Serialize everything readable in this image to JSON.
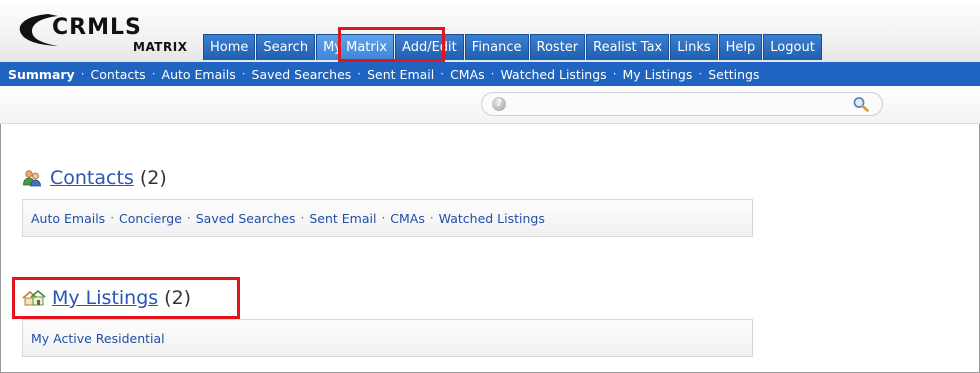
{
  "brand": {
    "logo_text": "CRMLS",
    "logo_subtext": "MATRIX",
    "accent_color": "#1e64c0",
    "highlight_color": "#e1151a"
  },
  "main_tabs": [
    {
      "label": "Home"
    },
    {
      "label": "Search"
    },
    {
      "label": "My Matrix",
      "active": true
    },
    {
      "label": "Add/Edit"
    },
    {
      "label": "Finance"
    },
    {
      "label": "Roster"
    },
    {
      "label": "Realist Tax"
    },
    {
      "label": "Links"
    },
    {
      "label": "Help"
    },
    {
      "label": "Logout"
    }
  ],
  "sub_nav": [
    {
      "label": "Summary",
      "current": true
    },
    {
      "label": "Contacts"
    },
    {
      "label": "Auto Emails"
    },
    {
      "label": "Saved Searches"
    },
    {
      "label": "Sent Email"
    },
    {
      "label": "CMAs"
    },
    {
      "label": "Watched Listings"
    },
    {
      "label": "My Listings"
    },
    {
      "label": "Settings"
    }
  ],
  "search": {
    "value": "",
    "help_icon": "help-icon",
    "search_icon": "magnifier-icon"
  },
  "contacts": {
    "title": "Contacts",
    "count": "(2)",
    "icon": "contacts-icon",
    "links": [
      "Auto Emails",
      "Concierge",
      "Saved Searches",
      "Sent Email",
      "CMAs",
      "Watched Listings"
    ]
  },
  "listings": {
    "title": "My Listings",
    "count": "(2)",
    "icon": "houses-icon",
    "links": [
      "My Active Residential"
    ]
  }
}
